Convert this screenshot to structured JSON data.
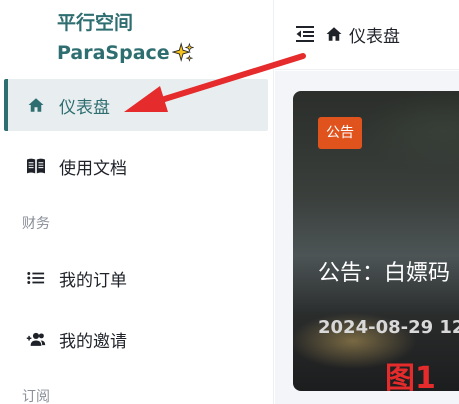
{
  "brand": {
    "title_line1": "平行空间",
    "title_line2": "ParaSpace"
  },
  "sidebar": {
    "items": [
      {
        "label": "仪表盘",
        "icon": "home-icon",
        "active": true
      },
      {
        "label": "使用文档",
        "icon": "book-icon",
        "active": false
      }
    ],
    "section_finance": "财务",
    "finance_items": [
      {
        "label": "我的订单",
        "icon": "list-icon"
      },
      {
        "label": "我的邀请",
        "icon": "user-add-icon"
      }
    ],
    "section_subscribe": "订阅"
  },
  "header": {
    "breadcrumb_title": "仪表盘"
  },
  "announcement": {
    "badge": "公告",
    "title": "公告：白嫖码",
    "date": "2024-08-29 12",
    "figure_label": "图1"
  },
  "colors": {
    "accent": "#2f6e70",
    "badge": "#e0531d",
    "annotation": "#e52b2b"
  }
}
